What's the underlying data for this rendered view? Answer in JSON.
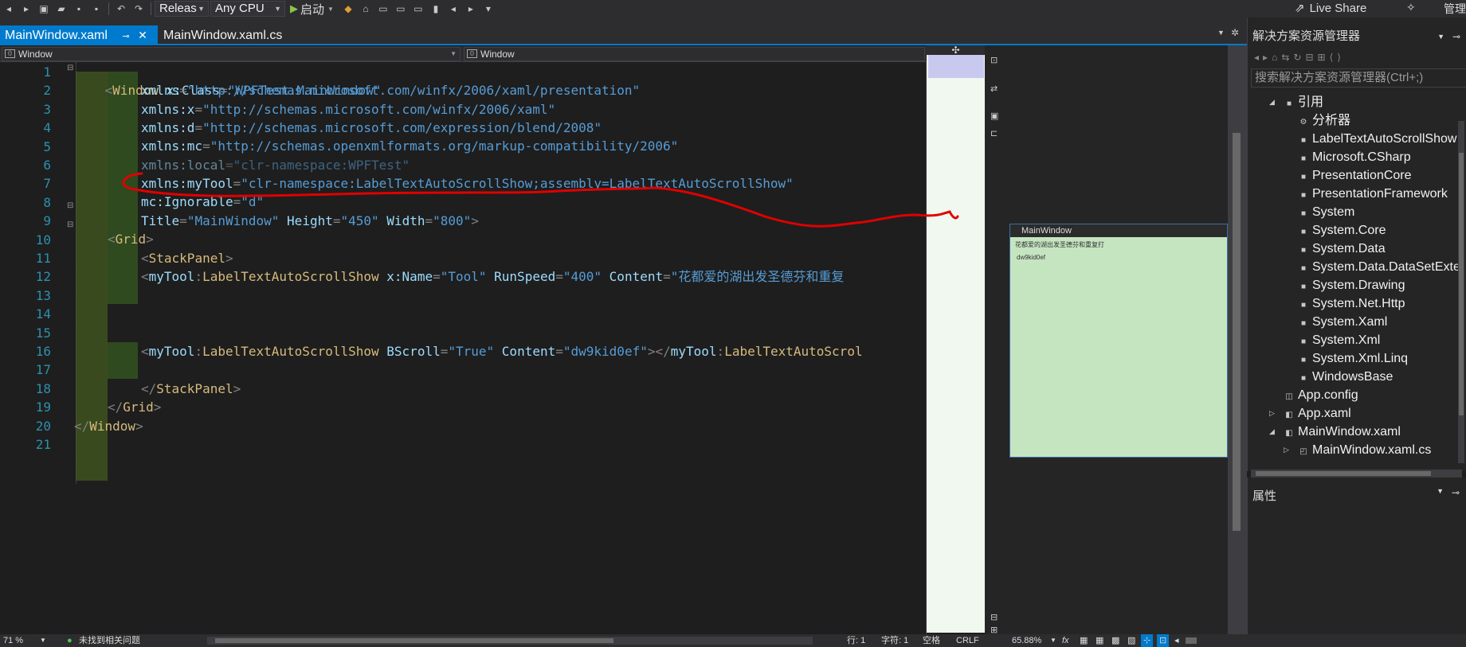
{
  "toolbar": {
    "config_value": "Releas",
    "platform_value": "Any CPU",
    "start_label": "启动",
    "live_share": "Live Share",
    "manage_label": "管理"
  },
  "tabs": [
    {
      "label": "MainWindow.xaml",
      "active": true
    },
    {
      "label": "MainWindow.xaml.cs",
      "active": false
    }
  ],
  "navbar": {
    "left_combo": "Window",
    "right_combo": "Window"
  },
  "editor": {
    "line_numbers": [
      "1",
      "2",
      "3",
      "4",
      "5",
      "6",
      "7",
      "8",
      "9",
      "10",
      "11",
      "12",
      "13",
      "14",
      "15",
      "16",
      "17",
      "18",
      "19",
      "20",
      "21"
    ],
    "lines": {
      "l1": {
        "open": "<",
        "tag": "Window",
        "attr": "x:Class",
        "eq": "=",
        "val": "\"WPFTest.MainWindow\""
      },
      "l2": {
        "attr": "xmlns",
        "eq": "=",
        "val": "\"http://schemas.microsoft.com/winfx/2006/xaml/presentation\""
      },
      "l3": {
        "attr": "xmlns:x",
        "eq": "=",
        "val": "\"http://schemas.microsoft.com/winfx/2006/xaml\""
      },
      "l4": {
        "attr": "xmlns:d",
        "eq": "=",
        "val": "\"http://schemas.microsoft.com/expression/blend/2008\""
      },
      "l5": {
        "attr": "xmlns:mc",
        "eq": "=",
        "val": "\"http://schemas.openxmlformats.org/markup-compatibility/2006\""
      },
      "l6": {
        "attr": "xmlns:local",
        "eq": "=",
        "val": "\"clr-namespace:WPFTest\""
      },
      "l7": {
        "attr": "xmlns:myTool",
        "eq": "=",
        "val": "\"clr-namespace:LabelTextAutoScrollShow;assembly=LabelTextAutoScrollShow\""
      },
      "l8": {
        "attr": "mc:Ignorable",
        "eq": "=",
        "val": "\"d\""
      },
      "l9": {
        "a1": "Title",
        "v1": "\"MainWindow\"",
        "a2": "Height",
        "v2": "\"450\"",
        "a3": "Width",
        "v3": "\"800\"",
        "close": ">"
      },
      "l10": {
        "open": "<",
        "tag": "Grid",
        "close": ">"
      },
      "l11": {
        "open": "<",
        "tag": "StackPanel",
        "close": ">"
      },
      "l12": {
        "open": "<",
        "prefix": "myTool",
        "colon": ":",
        "tag": "LabelTextAutoScrollShow",
        "a1": "x:Name",
        "v1": "\"Tool\"",
        "a2": "RunSpeed",
        "v2": "\"400\"",
        "a3": "Content",
        "v3": "\"花都爱的湖出发圣德芬和重复"
      },
      "l16": {
        "open": "<",
        "prefix": "myTool",
        "colon": ":",
        "tag": "LabelTextAutoScrollShow",
        "a1": "BScroll",
        "v1": "\"True\"",
        "a2": "Content",
        "v2": "\"dw9kid0ef\"",
        "close1": "></",
        "prefix2": "myTool",
        "colon2": ":",
        "tag2": "LabelTextAutoScrol"
      },
      "l18": {
        "open": "</",
        "tag": "StackPanel",
        "close": ">"
      },
      "l19": {
        "open": "</",
        "tag": "Grid",
        "close": ">"
      },
      "l20": {
        "open": "</",
        "tag": "Window",
        "close": ">"
      }
    }
  },
  "designer": {
    "window_title": "MainWindow",
    "label_text": "花都爱的湖出发圣德芬和重复打",
    "label2_text": "dw9kid0ef"
  },
  "solution_explorer": {
    "title": "解决方案资源管理器",
    "search_placeholder": "搜索解决方案资源管理器(Ctrl+;)",
    "references_label": "引用",
    "items": [
      "分析器",
      "LabelTextAutoScrollShow",
      "Microsoft.CSharp",
      "PresentationCore",
      "PresentationFramework",
      "System",
      "System.Core",
      "System.Data",
      "System.Data.DataSetExte",
      "System.Drawing",
      "System.Net.Http",
      "System.Xaml",
      "System.Xml",
      "System.Xml.Linq",
      "WindowsBase"
    ],
    "files": [
      "App.config",
      "App.xaml",
      "MainWindow.xaml",
      "MainWindow.xaml.cs"
    ]
  },
  "properties": {
    "title": "属性"
  },
  "status": {
    "zoom": "71 %",
    "issues": "未找到相关问题",
    "row": "行: 1",
    "col": "字符: 1",
    "space": "空格",
    "eol": "CRLF",
    "design_zoom": "65.88%"
  },
  "colors": {
    "accent": "#007acc",
    "annotation": "#e00000",
    "design_bg": "#c5e5c1"
  }
}
